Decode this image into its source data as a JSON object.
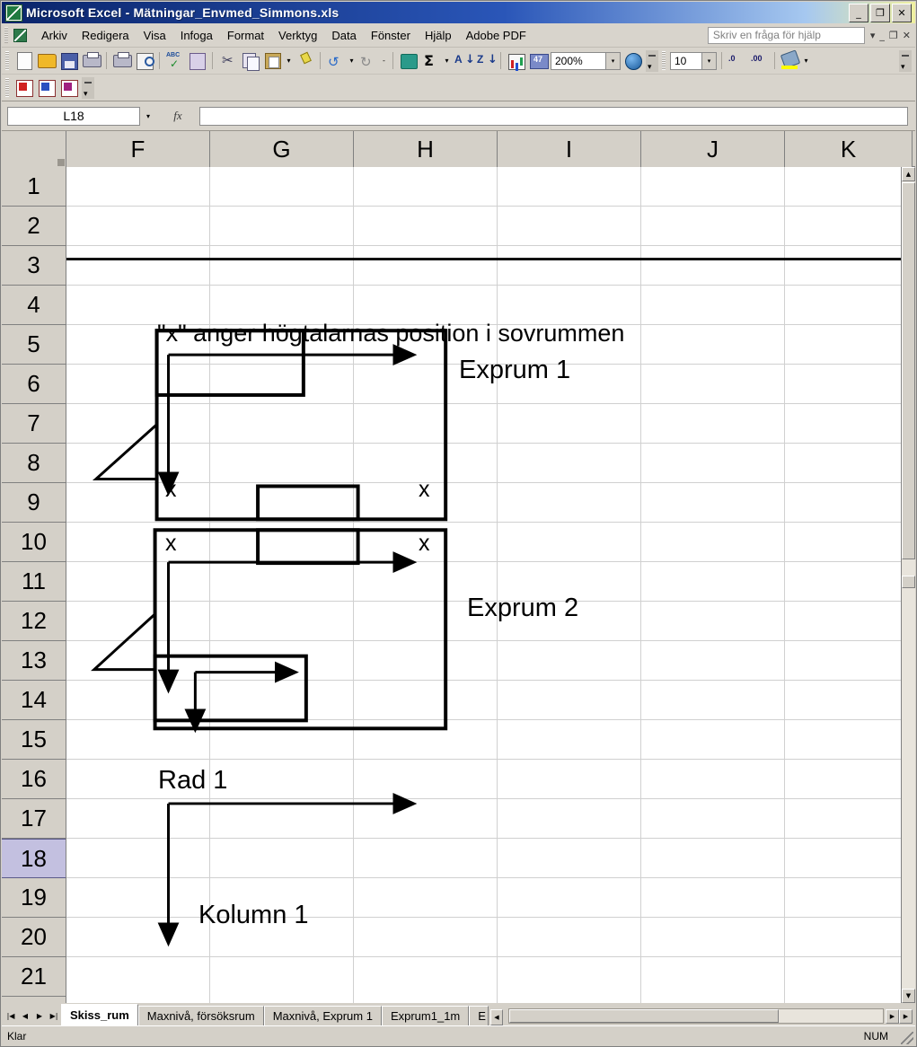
{
  "window": {
    "title": "Microsoft Excel - Mätningar_Envmed_Simmons.xls",
    "minimize_label": "_",
    "restore_label": "❐",
    "close_label": "✕"
  },
  "menu": {
    "items": [
      {
        "label": "Arkiv"
      },
      {
        "label": "Redigera"
      },
      {
        "label": "Visa"
      },
      {
        "label": "Infoga"
      },
      {
        "label": "Format"
      },
      {
        "label": "Verktyg"
      },
      {
        "label": "Data"
      },
      {
        "label": "Fönster"
      },
      {
        "label": "Hjälp"
      },
      {
        "label": "Adobe PDF"
      }
    ],
    "ask_placeholder": "Skriv en fråga för hjälp",
    "dropdown_glyph": "▾",
    "minimize_glyph": "_",
    "restore_glyph": "❐",
    "close_glyph": "✕"
  },
  "toolbar": {
    "zoom_value": "200%",
    "font_size_value": "10",
    "dropdown_glyph": "▾",
    "sum_glyph": "Σ",
    "cut_glyph": "✂",
    "undo_glyph": "↺",
    "redo_glyph": "↻",
    "dec_increase": ".0",
    "dec_decrease": ".00",
    "icons": [
      "new-document-icon",
      "open-folder-icon",
      "save-icon",
      "email-icon",
      "print-icon",
      "print-preview-icon",
      "spelling-icon",
      "research-icon",
      "cut-icon",
      "copy-icon",
      "paste-icon",
      "format-painter-icon",
      "undo-icon",
      "redo-icon",
      "hyperlink-icon",
      "autosum-icon",
      "sort-ascending-icon",
      "sort-descending-icon",
      "chart-wizard-icon",
      "drawing-icon",
      "zoom-select",
      "help-icon",
      "font-size-select",
      "increase-decimal-icon",
      "decrease-decimal-icon",
      "fill-color-icon"
    ],
    "pdf_icons": [
      "convert-to-pdf-icon",
      "convert-and-email-pdf-icon",
      "convert-and-review-pdf-icon"
    ]
  },
  "formula_bar": {
    "name_box_value": "L18",
    "fx_label": "fx",
    "formula_value": "",
    "dropdown_glyph": "▾"
  },
  "grid": {
    "columns": [
      "F",
      "G",
      "H",
      "I",
      "J",
      "K"
    ],
    "rows": [
      "1",
      "2",
      "3",
      "4",
      "5",
      "6",
      "7",
      "8",
      "9",
      "10",
      "11",
      "12",
      "13",
      "14",
      "15",
      "16",
      "17",
      "18",
      "19",
      "20",
      "21"
    ],
    "selected_row": "18"
  },
  "drawing": {
    "caption": "\"x\" anger högtalarnas position i sovrummen",
    "room1_label": "Exprum 1",
    "room2_label": "Exprum 2",
    "row_legend_label": "Rad 1",
    "column_legend_label": "Kolumn 1",
    "speaker_marker": "x",
    "room1_markers": [
      "x",
      "x"
    ],
    "room2_markers": [
      "x",
      "x"
    ]
  },
  "sheet_tabs": {
    "first_glyph": "|◀",
    "prev_glyph": "◀",
    "next_glyph": "▶",
    "last_glyph": "▶|",
    "scroll_right_glyph": "◀",
    "tabs": [
      {
        "label": "Skiss_rum",
        "active": true
      },
      {
        "label": "Maxnivå, försöksrum",
        "active": false
      },
      {
        "label": "Maxnivå, Exprum 1",
        "active": false
      },
      {
        "label": "Exprum1_1m",
        "active": false
      },
      {
        "label": "E",
        "active": false
      }
    ]
  },
  "scrollbars": {
    "up_glyph": "▲",
    "down_glyph": "▼",
    "left_glyph": "◀",
    "right_glyph": "▶"
  },
  "status_bar": {
    "mode": "Klar",
    "num_lock": "NUM"
  },
  "colors": {
    "title_start": "#0a246a",
    "title_end": "#f0f0a0",
    "chrome": "#d4d0c8",
    "selected_row": "#c3c0e0",
    "drawing_stroke": "#000000"
  }
}
